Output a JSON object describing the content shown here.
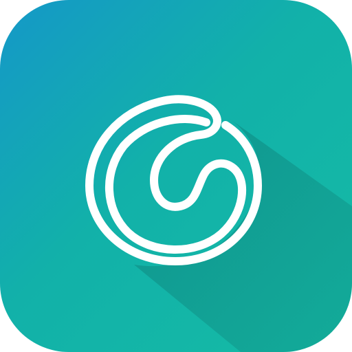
{
  "icon": {
    "name": "spiral-app-icon",
    "symbol": "spiral-icon",
    "colors": {
      "gradient_start": "#1598c8",
      "gradient_mid": "#12b1a9",
      "gradient_end": "#15bba5",
      "shadow": "#0e7f77",
      "glyph": "#ffffff"
    }
  }
}
